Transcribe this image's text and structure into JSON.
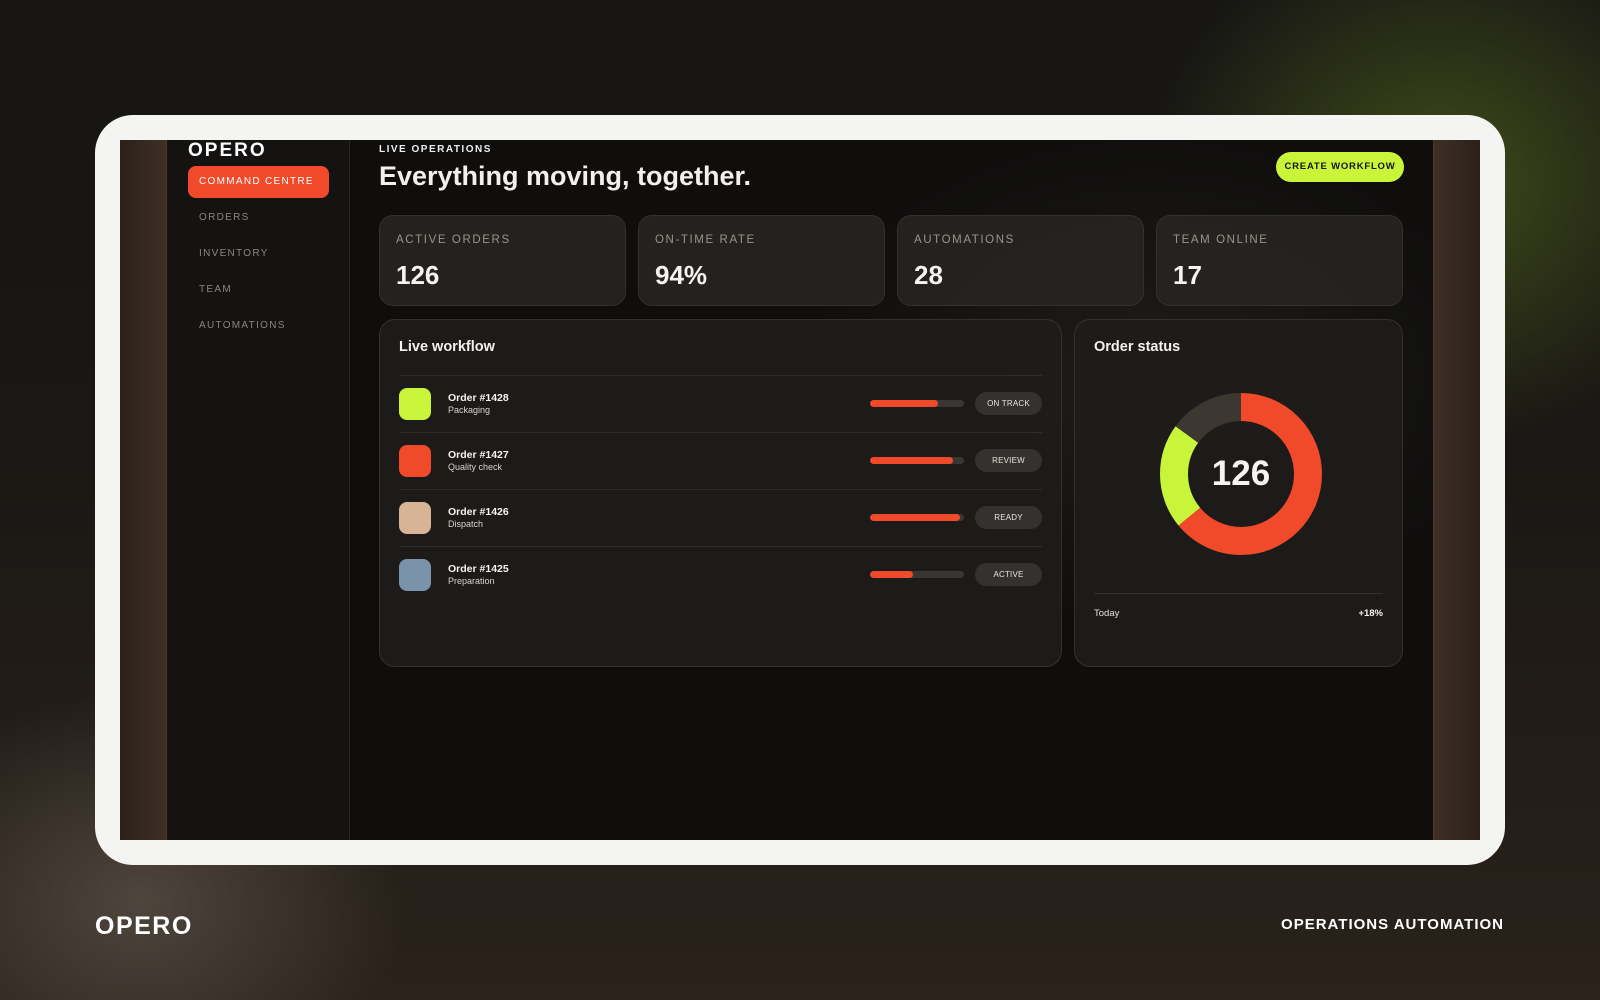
{
  "brand": "OPERO",
  "sidebar": {
    "items": [
      {
        "label": "COMMAND CENTRE",
        "active": true
      },
      {
        "label": "ORDERS",
        "active": false
      },
      {
        "label": "INVENTORY",
        "active": false
      },
      {
        "label": "TEAM",
        "active": false
      },
      {
        "label": "AUTOMATIONS",
        "active": false
      }
    ]
  },
  "header": {
    "eyebrow": "LIVE OPERATIONS",
    "title": "Everything moving, together.",
    "cta_label": "CREATE WORKFLOW"
  },
  "stats": [
    {
      "label": "ACTIVE ORDERS",
      "value": "126"
    },
    {
      "label": "ON-TIME RATE",
      "value": "94%"
    },
    {
      "label": "AUTOMATIONS",
      "value": "28"
    },
    {
      "label": "TEAM ONLINE",
      "value": "17"
    }
  ],
  "workflow": {
    "title": "Live workflow",
    "rows": [
      {
        "title": "Order #1428",
        "stage": "Packaging",
        "status": "ON TRACK",
        "progress": 0.72,
        "color": "#c8f53a"
      },
      {
        "title": "Order #1427",
        "stage": "Quality check",
        "status": "REVIEW",
        "progress": 0.88,
        "color": "#f04a2a"
      },
      {
        "title": "Order #1426",
        "stage": "Dispatch",
        "status": "READY",
        "progress": 0.96,
        "color": "#d7b496"
      },
      {
        "title": "Order #1425",
        "stage": "Preparation",
        "status": "ACTIVE",
        "progress": 0.46,
        "color": "#7a92aa"
      }
    ]
  },
  "order_status": {
    "title": "Order status",
    "total": "126",
    "footer_label": "Today",
    "footer_value": "+18%"
  },
  "chart_data": {
    "type": "pie",
    "categories": [
      "Orange",
      "Lime",
      "Dark"
    ],
    "values": [
      0.64,
      0.21,
      0.15
    ],
    "colors": [
      "#f04a2a",
      "#c8f53a",
      "#3c3731"
    ]
  },
  "footer": {
    "logo": "OPERO",
    "tagline": "OPERATIONS AUTOMATION"
  }
}
